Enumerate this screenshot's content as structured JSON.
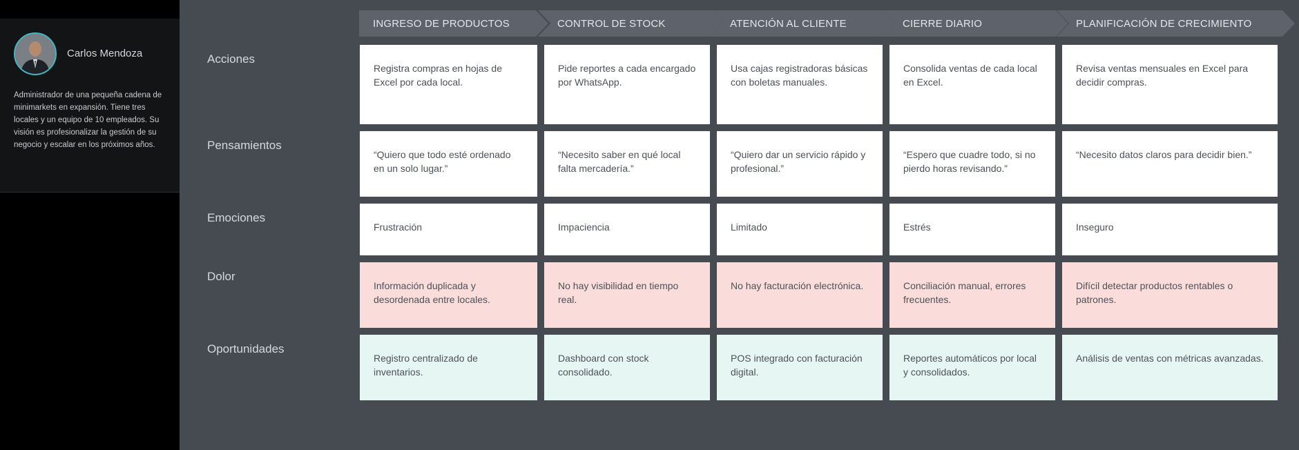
{
  "persona": {
    "name": "Carlos Mendoza",
    "description": "Administrador de una pequeña cadena de minimarkets en expansión. Tiene tres locales y un equipo de 10 empleados. Su visión es profesionalizar la gestión de su negocio y escalar en los próximos años."
  },
  "stages": [
    "INGRESO DE PRODUCTOS",
    "CONTROL DE STOCK",
    "ATENCIÓN AL CLIENTE",
    "CIERRE DIARIO",
    "PLANIFICACIÓN DE CRECIMIENTO"
  ],
  "rows": [
    {
      "label": "Acciones",
      "cells": [
        "Registra compras en hojas de Excel por cada local.",
        "Pide reportes a cada encargado por WhatsApp.",
        "Usa cajas registradoras básicas con boletas manuales.",
        "Consolida ventas de cada local en Excel.",
        "Revisa ventas mensuales en Excel para decidir compras."
      ]
    },
    {
      "label": "Pensamientos",
      "cells": [
        "“Quiero que todo esté ordenado en un solo lugar.”",
        "“Necesito saber en qué local falta mercadería.”",
        "“Quiero dar un servicio rápido y profesional.”",
        "“Espero que cuadre todo, si no pierdo horas revisando.”",
        "“Necesito datos claros para decidir bien.”"
      ]
    },
    {
      "label": "Emociones",
      "cells": [
        "Frustración",
        "Impaciencia",
        "Limitado",
        "Estrés",
        "Inseguro"
      ]
    },
    {
      "label": "Dolor",
      "cells": [
        "Información duplicada y desordenada entre locales.",
        "No hay visibilidad en tiempo real.",
        "No hay facturación electrónica.",
        "Conciliación manual, errores frecuentes.",
        "Difícil detectar productos rentables o patrones."
      ]
    },
    {
      "label": "Oportunidades",
      "cells": [
        "Registro centralizado de inventarios.",
        "Dashboard con stock consolidado.",
        "POS integrado con facturación digital.",
        "Reportes automáticos por local y consolidados.",
        "Análisis de ventas con métricas avanzadas."
      ]
    }
  ]
}
